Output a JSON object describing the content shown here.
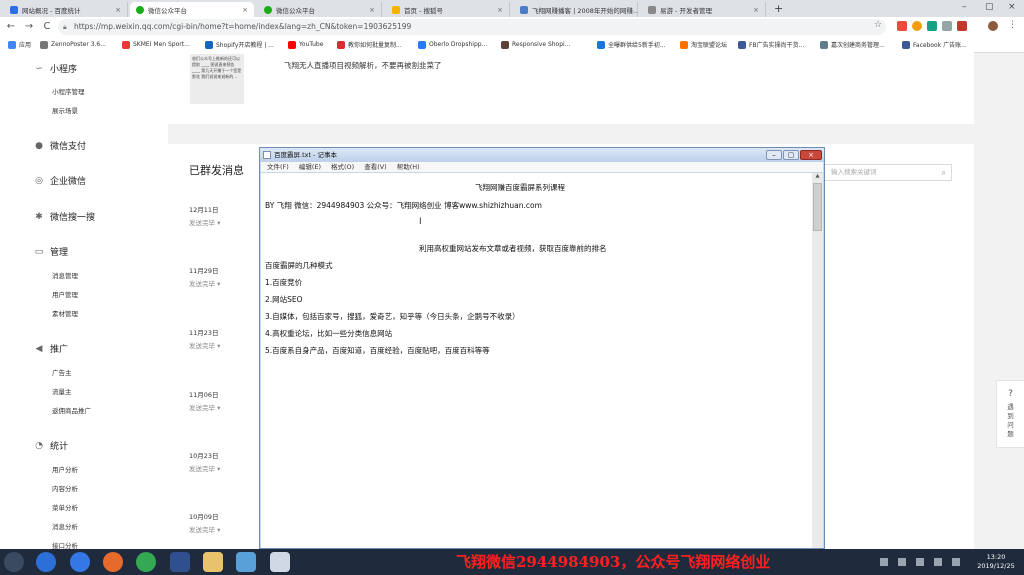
{
  "tabs": [
    {
      "label": "网站概况 - 百度统计",
      "icon_color": "#2a6ee8"
    },
    {
      "label": "微信公众平台",
      "icon_color": "#1aad19"
    },
    {
      "label": "微信公众平台",
      "icon_color": "#1aad19"
    },
    {
      "label": "首页 - 搜狐号",
      "icon_color": "#f5b400"
    },
    {
      "label": "飞翔网赚播客 | 2008年开始的网赚…",
      "icon_color": "#4a7cc7"
    },
    {
      "label": "易游 - 开发者管理",
      "icon_color": "#888888"
    }
  ],
  "address": {
    "url": "https://mp.weixin.qq.com/cgi-bin/home?t=home/index&lang=zh_CN&token=1903625199"
  },
  "nav": {
    "back": "←",
    "forward": "→",
    "reload": "C"
  },
  "bookmarks": [
    {
      "label": "应用",
      "color": "#4285f4"
    },
    {
      "label": "ZennoPoster 3.6...",
      "color": "#777777"
    },
    {
      "label": "SKMEI Men Sport...",
      "color": "#e53935"
    },
    {
      "label": "Shopify开店教程 | ...",
      "color": "#1565c0"
    },
    {
      "label": "YouTube",
      "color": "#ff0000"
    },
    {
      "label": "教你如何批量复制...",
      "color": "#d32f2f"
    },
    {
      "label": "Oberlo Dropshipp...",
      "color": "#2979ff"
    },
    {
      "label": "Responsive Shopi...",
      "color": "#5d4037"
    },
    {
      "label": "全曝群供给5新手初...",
      "color": "#1976d2"
    },
    {
      "label": "淘宝联盟论坛",
      "color": "#ff6f00"
    },
    {
      "label": "FB广告实操尚干货...",
      "color": "#3b5998"
    },
    {
      "label": "嘉次创建商务管理...",
      "color": "#607d8b"
    },
    {
      "label": "Facebook 广告账...",
      "color": "#3b5998"
    }
  ],
  "sidebar": {
    "sections": [
      {
        "label": "小程序",
        "icon": "mini-program-icon",
        "glyph": "∽"
      },
      {
        "label": "微信支付",
        "icon": "wechat-pay-icon",
        "glyph": "●"
      },
      {
        "label": "企业微信",
        "icon": "enterprise-wechat-icon",
        "glyph": "◎"
      },
      {
        "label": "微信搜一搜",
        "icon": "search-discover-icon",
        "glyph": "✱"
      },
      {
        "label": "管理",
        "icon": "manage-icon",
        "glyph": "▭"
      },
      {
        "label": "推广",
        "icon": "promotion-icon",
        "glyph": "◀"
      },
      {
        "label": "统计",
        "icon": "statistics-icon",
        "glyph": "◔"
      }
    ],
    "subs": [
      "小程序管理",
      "展示场景",
      "消息管理",
      "用户管理",
      "素材管理",
      "广告主",
      "流量主",
      "返佣商品推广",
      "用户分析",
      "内容分析",
      "菜单分析",
      "消息分析",
      "接口分析"
    ]
  },
  "card1": {
    "article_title": "飞翔无人直播项目视频解析，不要再被割韭菜了",
    "thumb_text": "爸们公众号上推新的还可以 提前 ____ 图说直来预告 ____ 第几天开播于一个签是那花 我们说说来说新的..."
  },
  "history": {
    "title": "已群发消息",
    "search_placeholder": "输入搜索关键词",
    "items": [
      {
        "date": "12月11日",
        "status": "发送完毕 ▾"
      },
      {
        "date": "11月29日",
        "status": "发送完毕 ▾"
      },
      {
        "date": "11月23日",
        "status": "发送完毕 ▾"
      },
      {
        "date": "11月06日",
        "status": "发送完毕 ▾"
      },
      {
        "date": "10月23日",
        "status": "发送完毕 ▾"
      },
      {
        "date": "10月09日",
        "status": "发送完毕 ▾"
      }
    ]
  },
  "notepad": {
    "title": "百度霸屏.txt - 记事本",
    "menu": [
      "文件(F)",
      "编辑(E)",
      "格式(O)",
      "查看(V)",
      "帮助(H)"
    ],
    "lines": [
      "飞翔网赚百度霸屏系列课程",
      "BY 飞翔    微信：2944984903    公众号：飞翔网络创业    博客www.shizhizhuan.com",
      "利用高权重网站发布文章或者视频，获取百度靠前的排名",
      "百度霸屏的几种模式",
      "1.百度竞价",
      "2.网站SEO",
      "3.自媒体，包括百家号，搜狐，爱奇艺，知乎等（今日头条，企鹅号不收录）",
      "4.高权重论坛，比如一些分类信息网站",
      "5.百度系自身产品，百度知道，百度经验，百度贴吧，百度百科等等"
    ]
  },
  "help": {
    "label": "遇到问题"
  },
  "taskbar": {
    "promo": "飞翔微信2944984903，公众号飞翔网络创业",
    "time": "13:20",
    "date": "2019/12/25"
  }
}
